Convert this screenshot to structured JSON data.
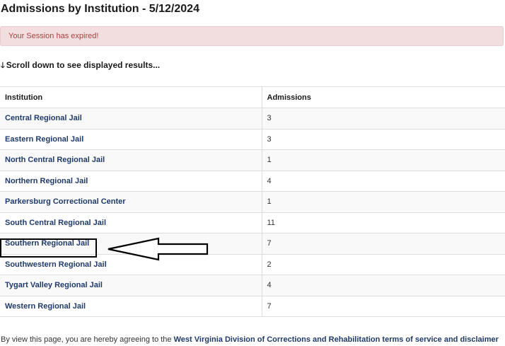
{
  "page": {
    "title": "Admissions by Institution - 5/12/2024"
  },
  "alert": {
    "message": "Your Session has expired!"
  },
  "scroll_hint": {
    "icon": "arrow-down-icon",
    "arrow_glyph": "🡓",
    "text": "Scroll down to see displayed results..."
  },
  "table": {
    "headers": {
      "institution": "Institution",
      "admissions": "Admissions"
    },
    "rows": [
      {
        "institution": "Central Regional Jail",
        "admissions": "3"
      },
      {
        "institution": "Eastern Regional Jail",
        "admissions": "3"
      },
      {
        "institution": "North Central Regional Jail",
        "admissions": "1"
      },
      {
        "institution": "Northern Regional Jail",
        "admissions": "4"
      },
      {
        "institution": "Parkersburg Correctional Center",
        "admissions": "1"
      },
      {
        "institution": "South Central Regional Jail",
        "admissions": "11"
      },
      {
        "institution": "Southern Regional Jail",
        "admissions": "7"
      },
      {
        "institution": "Southwestern Regional Jail",
        "admissions": "2"
      },
      {
        "institution": "Tygart Valley Regional Jail",
        "admissions": "4"
      },
      {
        "institution": "Western Regional Jail",
        "admissions": "7"
      }
    ]
  },
  "footer": {
    "prefix": "By view this page, you are hereby agreeing to the ",
    "link_text": "West Virginia Division of Corrections and Rehabilitation terms of service and disclaimer"
  },
  "annotation": {
    "highlighted_row": "Southern Regional Jail",
    "arrow_icon": "left-arrow-outline-icon",
    "colors": {
      "box": "#000000",
      "arrow_fill": "#ffffff"
    }
  }
}
